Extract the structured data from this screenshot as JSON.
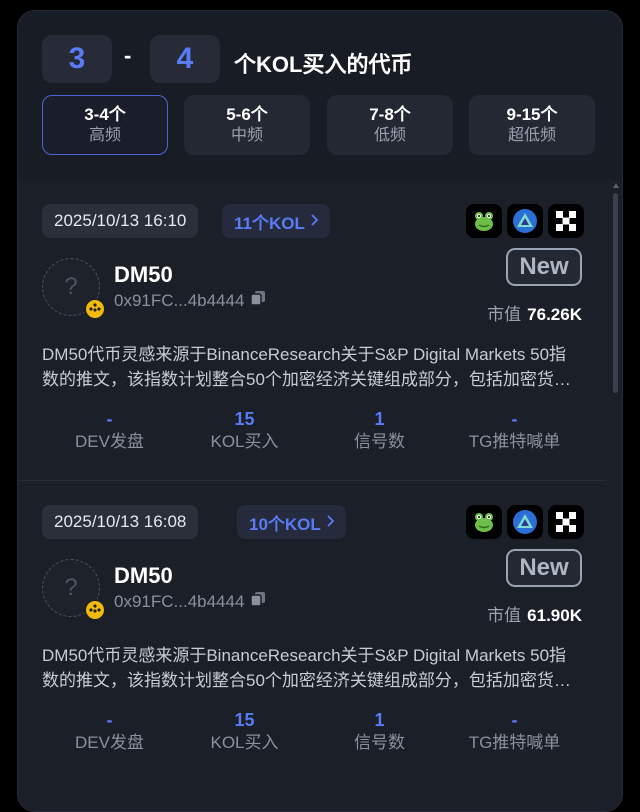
{
  "header": {
    "range_min": "3",
    "range_sep": "-",
    "range_max": "4",
    "title": "个KOL买入的代币",
    "tabs": [
      {
        "range": "3-4个",
        "label": "高频",
        "active": true
      },
      {
        "range": "5-6个",
        "label": "中频",
        "active": false
      },
      {
        "range": "7-8个",
        "label": "低频",
        "active": false
      },
      {
        "range": "9-15个",
        "label": "超低频",
        "active": false
      }
    ]
  },
  "tokens": [
    {
      "datetime": "2025/10/13 16:10",
      "kol_count": "11个KOL",
      "name": "DM50",
      "address": "0x91FC...4b4444",
      "badge": "New",
      "market_cap_label": "市值",
      "market_cap": "76.26K",
      "description": "DM50代币灵感来源于BinanceResearch关于S&P Digital Markets 50指数的推文，该指数计划整合50个加密经济关键组成部分，包括加密货币及相关股票。",
      "stats": [
        {
          "value": "-",
          "label": "DEV发盘"
        },
        {
          "value": "15",
          "label": "KOL买入"
        },
        {
          "value": "1",
          "label": "信号数"
        },
        {
          "value": "-",
          "label": "TG推特喊单"
        }
      ]
    },
    {
      "datetime": "2025/10/13 16:08",
      "kol_count": "10个KOL",
      "name": "DM50",
      "address": "0x91FC...4b4444",
      "badge": "New",
      "market_cap_label": "市值",
      "market_cap": "61.90K",
      "description": "DM50代币灵感来源于BinanceResearch关于S&P Digital Markets 50指数的推文，该指数计划整合50个加密经济关键组成部分，包括加密货币及相关股票。",
      "stats": [
        {
          "value": "-",
          "label": "DEV发盘"
        },
        {
          "value": "15",
          "label": "KOL买入"
        },
        {
          "value": "1",
          "label": "信号数"
        },
        {
          "value": "-",
          "label": "TG推特喊单"
        }
      ]
    }
  ],
  "icons": [
    "frog-icon",
    "triangle-logo-icon",
    "x-icon"
  ],
  "colors": {
    "accent": "#5a7bf5",
    "bnb": "#f0b90b",
    "panel": "#181c25"
  }
}
